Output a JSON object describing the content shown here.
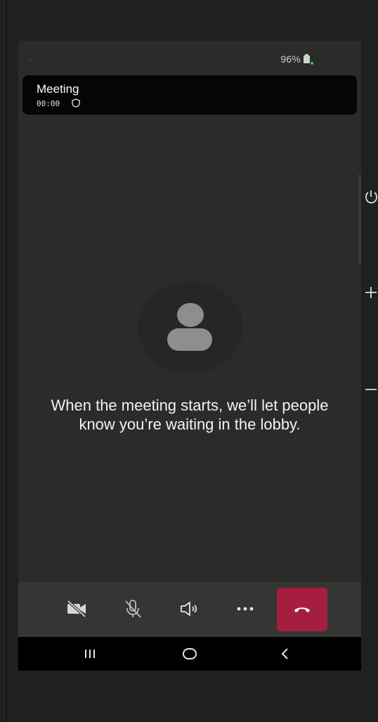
{
  "status_bar": {
    "battery_percent": "96%",
    "battery_icon": "battery-charging-icon",
    "indicator_color": "#2ecc40"
  },
  "meeting": {
    "title": "Meeting",
    "timer": "00:00",
    "security_icon": "shield-icon"
  },
  "lobby": {
    "avatar_icon": "person-icon",
    "message": "When the meeting starts, we’ll let people know you’re waiting in the lobby."
  },
  "controls": [
    {
      "name": "camera-toggle-button",
      "icon": "video-off-icon"
    },
    {
      "name": "mic-toggle-button",
      "icon": "mic-off-icon"
    },
    {
      "name": "speaker-button",
      "icon": "speaker-icon"
    },
    {
      "name": "more-options-button",
      "icon": "more-horizontal-icon"
    },
    {
      "name": "hang-up-button",
      "icon": "phone-hangup-icon",
      "color": "#a51e3f"
    }
  ],
  "nav_bar": {
    "recent_icon": "recent-apps-icon",
    "home_icon": "home-icon",
    "back_icon": "back-icon"
  },
  "device_side_controls": {
    "power_icon": "power-icon",
    "volume_up_icon": "plus-icon",
    "volume_down_icon": "minus-icon"
  },
  "colors": {
    "screen_bg": "#2b2b29",
    "controls_bg": "#353533",
    "header_bg": "#050505"
  }
}
